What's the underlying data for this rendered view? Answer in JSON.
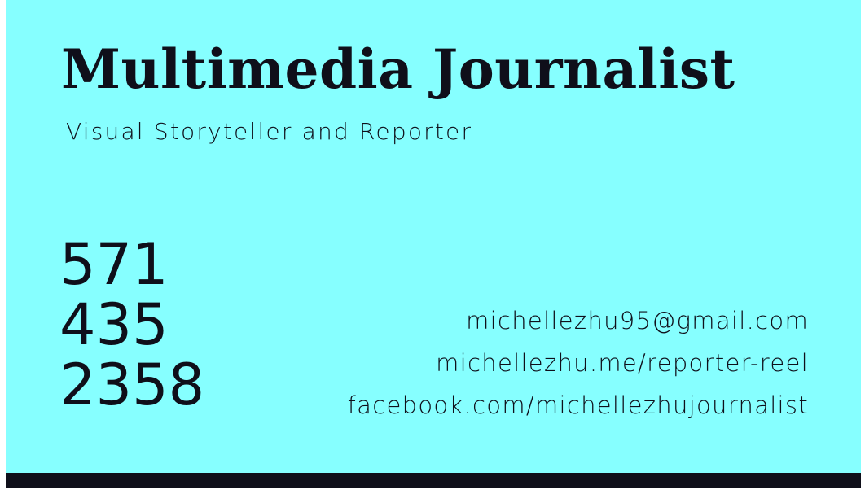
{
  "card": {
    "title": "Multimedia Journalist",
    "subtitle": "Visual Storyteller and Reporter",
    "phone": [
      "571",
      "435",
      "2358"
    ],
    "contacts": {
      "email": "michellezhu95@gmail.com",
      "website": "michellezhu.me/reporter-reel",
      "facebook": "facebook.com/michellezhujournalist"
    }
  },
  "colors": {
    "background": "#86ffff",
    "text": "#0f0f1a",
    "bar": "#0f0f1a"
  }
}
